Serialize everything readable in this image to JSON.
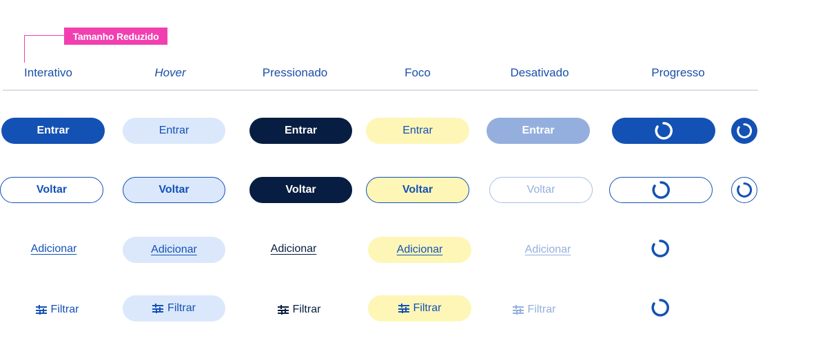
{
  "annotation": {
    "label": "Tamanho Reduzido"
  },
  "headers": [
    "Interativo",
    "Hover",
    "Pressionado",
    "Foco",
    "Desativado",
    "Progresso"
  ],
  "buttons": {
    "primary_label": "Entrar",
    "secondary_label": "Voltar",
    "tertiary_label": "Adicionar",
    "filter_label": "Filtrar"
  },
  "colors": {
    "primary": "#1351b4",
    "pressed": "#071d41",
    "hover_bg": "#dbe8fb",
    "focus_bg": "#fef6b7",
    "disabled": "#94afdd",
    "annotation": "#f23fb0"
  },
  "icons": {
    "filter": "sliders-icon",
    "progress": "spinner-icon"
  }
}
